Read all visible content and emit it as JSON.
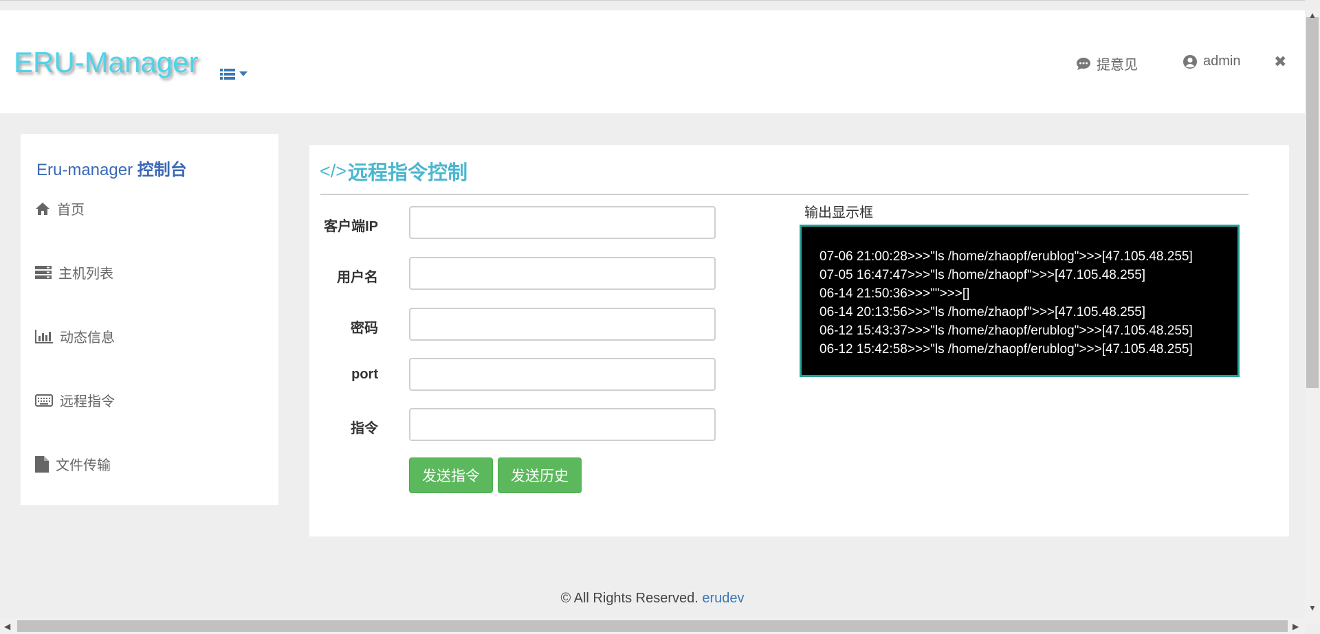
{
  "header": {
    "logo": "ERU-Manager",
    "feedback": "提意见",
    "user": "admin",
    "close_glyph": "✖"
  },
  "sidebar": {
    "title_prefix": "Eru-manager",
    "title_bold": "控制台",
    "items": [
      {
        "label": "首页",
        "icon": "home-icon"
      },
      {
        "label": "主机列表",
        "icon": "server-icon"
      },
      {
        "label": "动态信息",
        "icon": "bar-chart-icon"
      },
      {
        "label": "远程指令",
        "icon": "keyboard-icon"
      },
      {
        "label": "文件传输",
        "icon": "file-icon"
      }
    ]
  },
  "main": {
    "title_code": "</>",
    "title": "远程指令控制",
    "fields": [
      {
        "label": "客户端IP",
        "value": ""
      },
      {
        "label": "用户名",
        "value": ""
      },
      {
        "label": "密码",
        "value": ""
      },
      {
        "label": "port",
        "value": ""
      },
      {
        "label": "指令",
        "value": ""
      }
    ],
    "send_button": "发送指令",
    "history_button": "发送历史",
    "output_label": "输出显示框",
    "output_lines": [
      "07-06 21:00:28>>>\"ls /home/zhaopf/erublog\">>>[47.105.48.255]",
      "07-05 16:47:47>>>\"ls /home/zhaopf\">>>[47.105.48.255]",
      "06-14 21:50:36>>>\"\">>>[]",
      "06-14 20:13:56>>>\"ls /home/zhaopf\">>>[47.105.48.255]",
      "06-12 15:43:37>>>\"ls /home/zhaopf/erublog\">>>[47.105.48.255]",
      "06-12 15:42:58>>>\"ls /home/zhaopf/erublog\">>>[47.105.48.255]"
    ]
  },
  "footer": {
    "text": "© All Rights Reserved.",
    "link": "erudev"
  },
  "colors": {
    "accent": "#4bb7cf",
    "logo": "#4fd3e8",
    "button": "#5cb85c",
    "output_border": "#2aa198",
    "sidebar_title": "#3a68b5"
  }
}
